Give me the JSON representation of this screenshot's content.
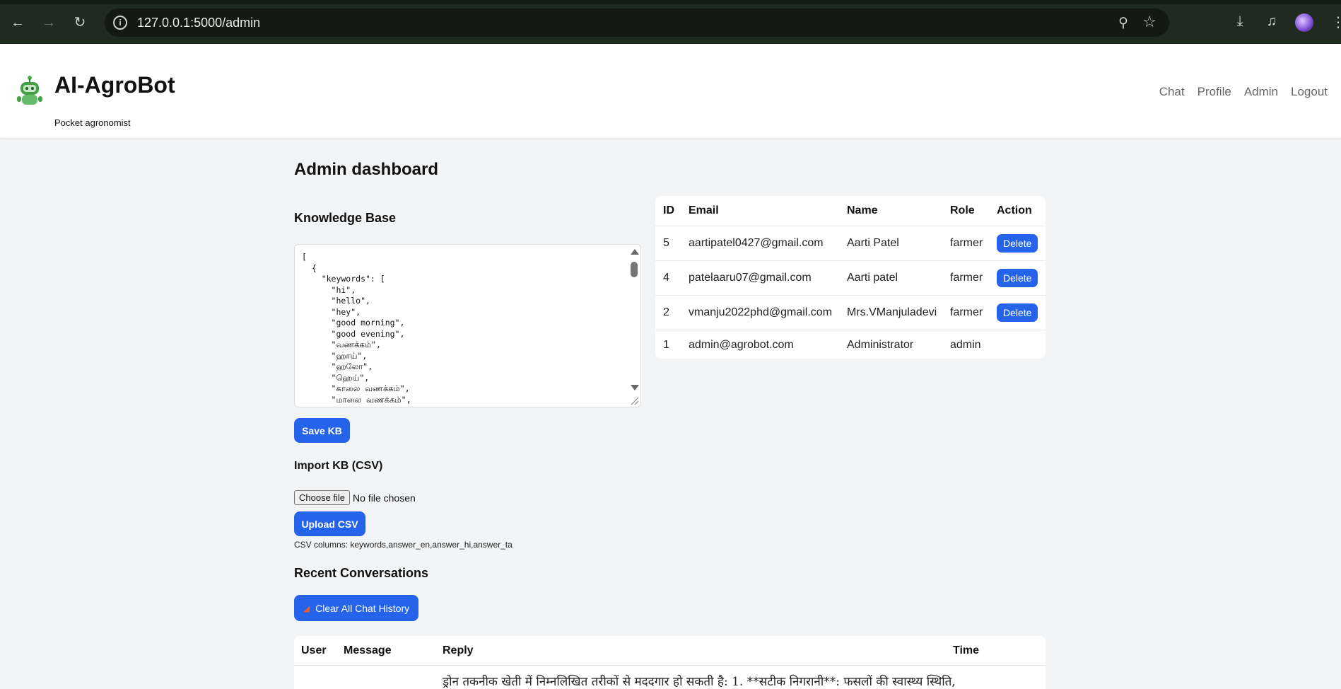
{
  "browser": {
    "url": "127.0.0.1:5000/admin"
  },
  "header": {
    "title": "AI-AgroBot",
    "subtitle": "Pocket agronomist",
    "nav": [
      "Chat",
      "Profile",
      "Admin",
      "Logout"
    ]
  },
  "page": {
    "title": "Admin dashboard"
  },
  "knowledge_base": {
    "heading": "Knowledge Base",
    "content": "[\n  {\n    \"keywords\": [\n      \"hi\",\n      \"hello\",\n      \"hey\",\n      \"good morning\",\n      \"good evening\",\n      \"வணக்கம்\",\n      \"ஹாய்\",\n      \"ஹலோ\",\n      \"ஹெய்\",\n      \"காலை வணக்கம்\",\n      \"மாலை வணக்கம்\",",
    "save_label": "Save KB"
  },
  "import": {
    "heading": "Import KB (CSV)",
    "choose_label": "Choose file",
    "file_status": "No file chosen",
    "upload_label": "Upload CSV",
    "note": "CSV columns: keywords,answer_en,answer_hi,answer_ta"
  },
  "users": {
    "columns": [
      "ID",
      "Email",
      "Name",
      "Role",
      "Action"
    ],
    "rows": [
      {
        "id": "5",
        "email": "aartipatel0427@gmail.com",
        "name": "Aarti Patel",
        "role": "farmer",
        "action": "Delete"
      },
      {
        "id": "4",
        "email": "patelaaru07@gmail.com",
        "name": "Aarti patel",
        "role": "farmer",
        "action": "Delete"
      },
      {
        "id": "2",
        "email": "vmanju2022phd@gmail.com",
        "name": "Mrs.VManjuladevi",
        "role": "farmer",
        "action": "Delete"
      },
      {
        "id": "1",
        "email": "admin@agrobot.com",
        "name": "Administrator",
        "role": "admin",
        "action": ""
      }
    ]
  },
  "conversations": {
    "heading": "Recent Conversations",
    "clear_label": "Clear All Chat History",
    "columns": [
      "User",
      "Message",
      "Reply",
      "Time"
    ],
    "first_reply": "ड्रोन तकनीक खेती में निम्नलिखित तरीकों से मददगार हो सकती है: 1. **सटीक निगरानी**: फसलों की स्वास्थ्य स्थिति,"
  }
}
